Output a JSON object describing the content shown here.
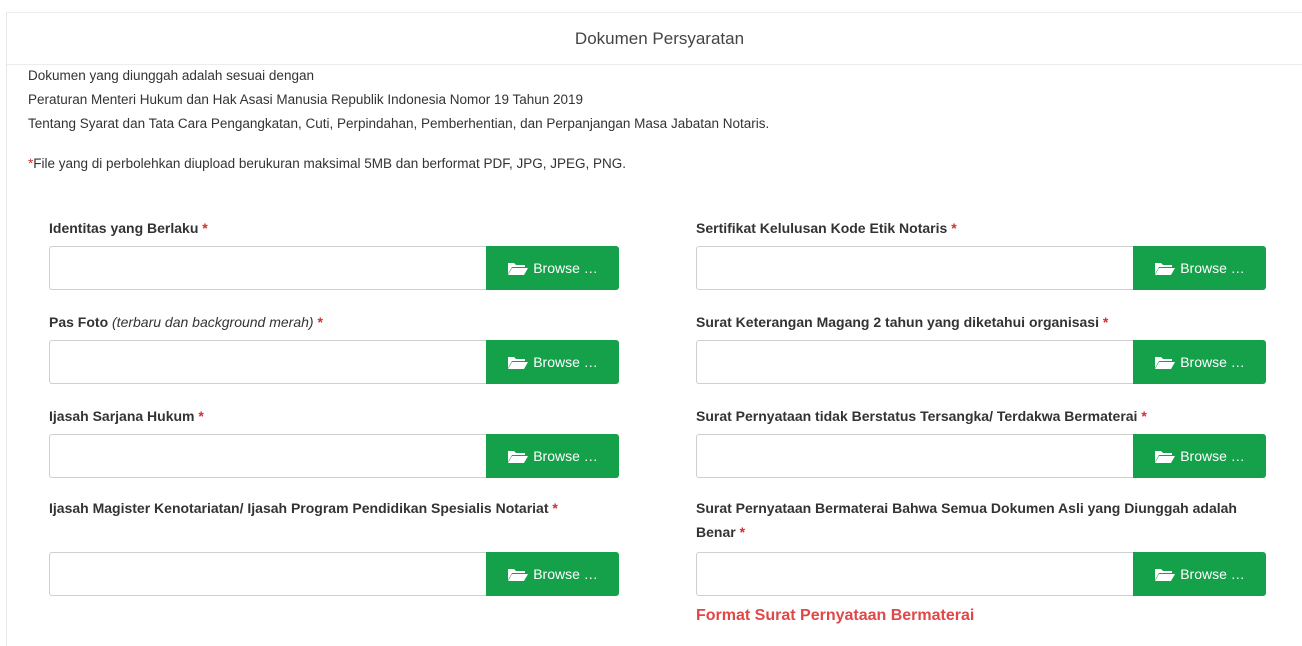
{
  "header": {
    "title": "Dokumen Persyaratan"
  },
  "intro": {
    "line1": "Dokumen yang diunggah adalah sesuai dengan",
    "line2": "Peraturan Menteri Hukum dan Hak Asasi Manusia Republik Indonesia Nomor 19 Tahun 2019",
    "line3": "Tentang Syarat dan Tata Cara Pengangkatan, Cuti, Perpindahan, Pemberhentian, dan Perpanjangan Masa Jabatan Notaris."
  },
  "note": {
    "star": "*",
    "text": "File yang di perbolehkan diupload berukuran maksimal 5MB dan berformat PDF, JPG, JPEG, PNG."
  },
  "required_mark": "*",
  "browse_label": "Browse …",
  "fields_left": [
    {
      "label": "Identitas yang Berlaku",
      "hint": ""
    },
    {
      "label": "Pas Foto",
      "hint": "(terbaru dan background merah)"
    },
    {
      "label": "Ijasah Sarjana Hukum",
      "hint": ""
    },
    {
      "label": "Ijasah Magister Kenotariatan/ Ijasah Program Pendidikan Spesialis Notariat",
      "hint": ""
    }
  ],
  "fields_right": [
    {
      "label": "Sertifikat Kelulusan Kode Etik Notaris",
      "hint": ""
    },
    {
      "label": "Surat Keterangan Magang 2 tahun yang diketahui organisasi",
      "hint": ""
    },
    {
      "label": "Surat Pernyataan tidak Berstatus Tersangka/ Terdakwa Bermaterai",
      "hint": ""
    },
    {
      "label": "Surat Pernyataan Bermaterai Bahwa Semua Dokumen Asli yang Diunggah adalah Benar",
      "hint": ""
    }
  ],
  "format_link": "Format Surat Pernyataan Bermaterai",
  "colors": {
    "accent": "#14a14a",
    "required": "#d32f2f",
    "link": "#e04848"
  },
  "icons": {
    "browse": "folder-open-icon"
  }
}
